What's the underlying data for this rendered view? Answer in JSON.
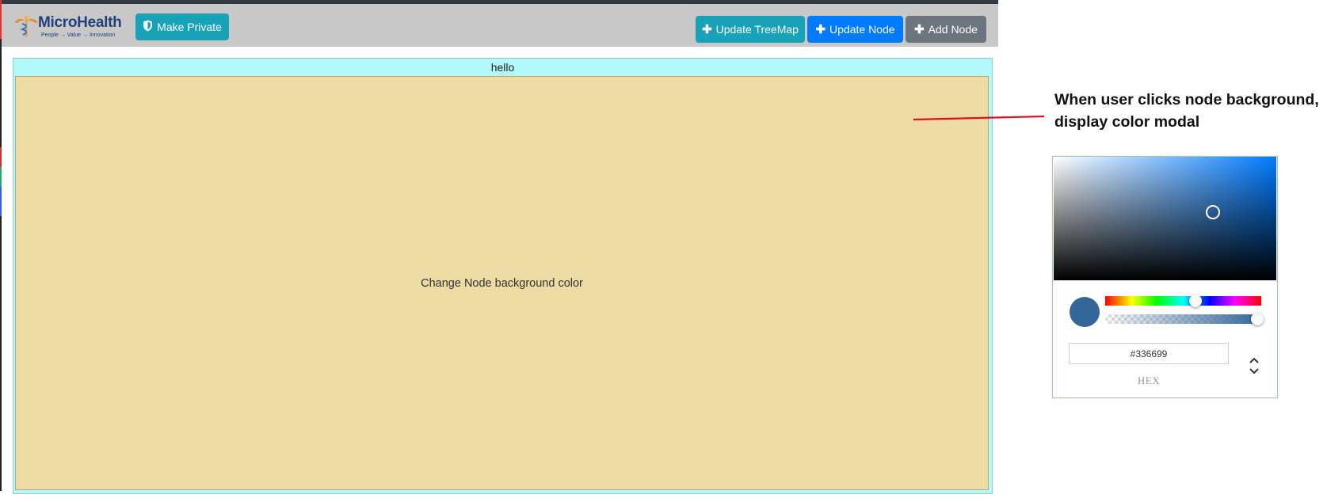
{
  "header": {
    "logo": {
      "name": "MicroHealth",
      "tagline": "People → Value → Innovation"
    },
    "make_private_label": "Make Private",
    "update_treemap_label": "Update TreeMap",
    "update_node_label": "Update Node",
    "add_node_label": "Add Node"
  },
  "treemap": {
    "root_label": "hello",
    "root_color": "#b3f9fb",
    "node_label": "Change Node background color",
    "node_color": "#eedaa3"
  },
  "annotation": {
    "text": "When user clicks node background, display color modal",
    "line_color": "#e0101a"
  },
  "color_picker": {
    "hex_value": "#336699",
    "mode_label": "HEX",
    "hue_color": "#007bff",
    "preview_color": "#336699",
    "alpha_percent": 100
  },
  "icons": {
    "make_private": "shield-icon",
    "update_treemap": "plus-icon",
    "update_node": "plus-icon",
    "add_node": "plus-icon",
    "mode_toggle": "chevron-up-down-icon"
  }
}
